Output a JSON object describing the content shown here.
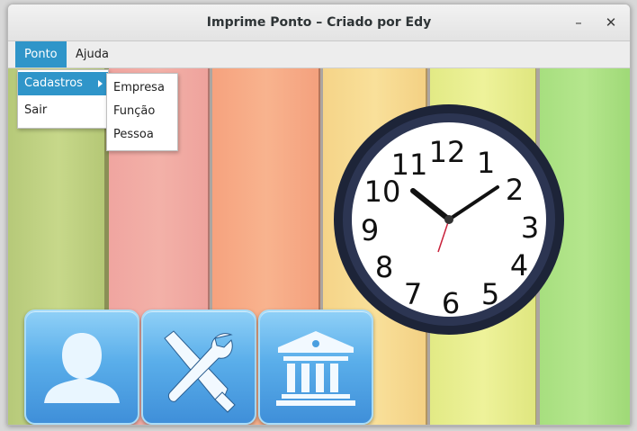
{
  "window": {
    "title": "Imprime Ponto – Criado por Edy"
  },
  "titlebar_buttons": {
    "minimize": "–",
    "close": "✕"
  },
  "menubar": {
    "items": [
      "Ponto",
      "Ajuda"
    ]
  },
  "ponto_menu": {
    "items": [
      "Cadastros",
      "Sair"
    ]
  },
  "cadastros_submenu": {
    "items": [
      "Empresa",
      "Função",
      "Pessoa"
    ]
  },
  "clock": {
    "numbers": [
      "12",
      "1",
      "2",
      "3",
      "4",
      "5",
      "6",
      "7",
      "8",
      "9",
      "10",
      "11"
    ]
  },
  "tiles": [
    {
      "icon": "person-icon"
    },
    {
      "icon": "tools-icon"
    },
    {
      "icon": "bank-icon"
    }
  ],
  "colors": {
    "accent": "#2f95c9",
    "tile": "#4a9fe0"
  }
}
